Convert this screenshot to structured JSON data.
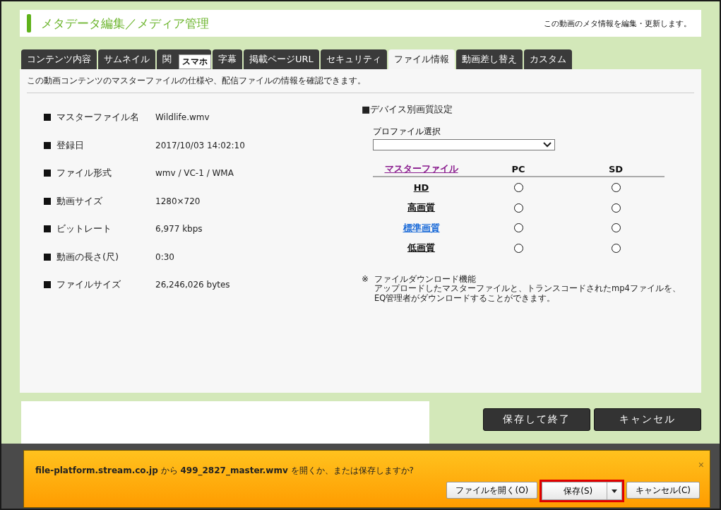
{
  "header": {
    "title": "メタデータ編集／メディア管理",
    "note": "この動画のメタ情報を編集・更新します。"
  },
  "tabs": [
    {
      "label": "コンテンツ内容",
      "selected": false
    },
    {
      "label": "サムネイル",
      "selected": false
    },
    {
      "label": "関",
      "selected": false
    },
    {
      "label": "字幕",
      "selected": false
    },
    {
      "label": "掲載ページURL",
      "selected": false
    },
    {
      "label": "セキュリティ",
      "selected": false
    },
    {
      "label": "ファイル情報",
      "selected": true
    },
    {
      "label": "動画差し替え",
      "selected": false
    },
    {
      "label": "カスタム",
      "selected": false
    }
  ],
  "tab_overlay": "スマホ",
  "description": "この動画コンテンツのマスターファイルの仕様や、配信ファイルの情報を確認できます。",
  "file_info": [
    {
      "label": "マスターファイル名",
      "value": "Wildlife.wmv"
    },
    {
      "label": "登録日",
      "value": "2017/10/03 14:02:10"
    },
    {
      "label": "ファイル形式",
      "value": "wmv / VC-1 / WMA"
    },
    {
      "label": "動画サイズ",
      "value": "1280×720"
    },
    {
      "label": "ビットレート",
      "value": "6,977 kbps"
    },
    {
      "label": "動画の長さ(尺)",
      "value": "0:30"
    },
    {
      "label": "ファイルサイズ",
      "value": "26,246,026 bytes"
    }
  ],
  "device_quality": {
    "title": "■デバイス別画質設定",
    "profile_label": "プロファイル選択",
    "columns": [
      {
        "label": "マスターファイル",
        "kind": "visited"
      },
      {
        "label": "PC",
        "kind": "plain"
      },
      {
        "label": "SD",
        "kind": "plain"
      }
    ],
    "rows": [
      {
        "label": "HD",
        "kind": "plain",
        "pc_checked": false,
        "sd_checked": false
      },
      {
        "label": "高画質",
        "kind": "plain",
        "pc_checked": false,
        "sd_checked": false
      },
      {
        "label": "標準画質",
        "kind": "link",
        "pc_checked": false,
        "sd_checked": false
      },
      {
        "label": "低画質",
        "kind": "plain",
        "pc_checked": false,
        "sd_checked": false
      }
    ],
    "note_mark": "※",
    "note_title": "ファイルダウンロード機能",
    "note_lines": [
      "アップロードしたマスターファイルと、トランスコードされたmp4ファイルを、",
      "EQ管理者がダウンロードすることができます。"
    ]
  },
  "buttons": [
    "保存して終了",
    "キャンセル"
  ],
  "download_bar": {
    "message": "**file-platform.stream.co.jp** から **499_2827_master.wmv** を開くか、または保存しますか?",
    "close": "×",
    "buttons": [
      {
        "label": "ファイルを開く(O)",
        "highlighted": false,
        "kind": "plain"
      },
      {
        "label": "保存(S)",
        "highlighted": true,
        "kind": "split"
      },
      {
        "label": "キャンセル(C)",
        "highlighted": false,
        "kind": "plain"
      }
    ]
  }
}
